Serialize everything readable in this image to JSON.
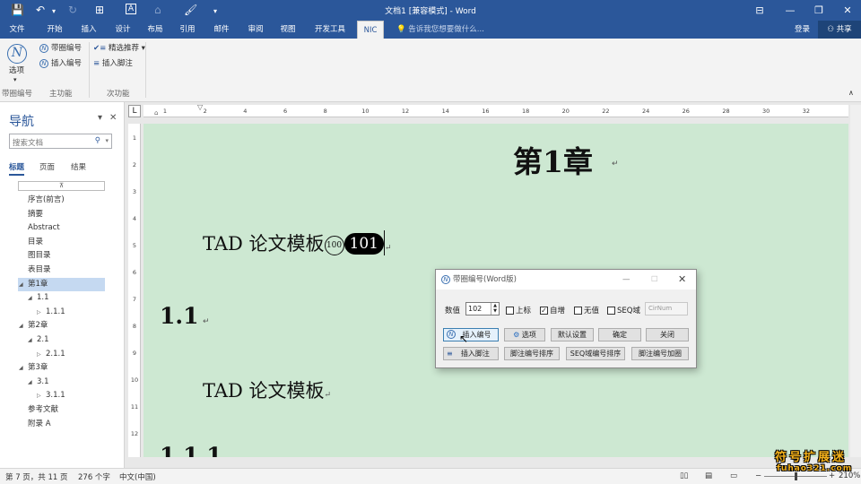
{
  "titlebar": {
    "title": "文档1 [兼容模式] - Word",
    "icons": [
      "save-icon",
      "undo-icon",
      "redo-icon",
      "table-icon",
      "text-box-icon",
      "format-painter-icon",
      "quick-access-dropdown-icon"
    ],
    "window_controls": [
      "ribbon-display-icon",
      "minimize-icon",
      "restore-icon",
      "close-icon"
    ]
  },
  "ribbon_tabs": [
    "文件",
    "开始",
    "插入",
    "设计",
    "布局",
    "引用",
    "邮件",
    "审阅",
    "视图",
    "开发工具",
    "NIC"
  ],
  "active_tab": "NIC",
  "tell_me": "告诉我您想要做什么...",
  "login": "登录",
  "share": "共享",
  "ribbon": {
    "options_big": "选项",
    "btn_circled_number": "带圈编号",
    "btn_insert_number": "插入编号",
    "btn_featured": "精选推荐",
    "btn_insert_footnote": "插入脚注",
    "group_labels": [
      "带圈编号",
      "主功能",
      "次功能"
    ]
  },
  "nav": {
    "title": "导航",
    "search_placeholder": "搜索文档",
    "tabs": [
      "标题",
      "页面",
      "结果"
    ],
    "items": [
      {
        "label": "序言(前言)",
        "level": 0,
        "caret": "",
        "selected": false
      },
      {
        "label": "摘要",
        "level": 0,
        "caret": "",
        "selected": false
      },
      {
        "label": "Abstract",
        "level": 0,
        "caret": "",
        "selected": false
      },
      {
        "label": "目录",
        "level": 0,
        "caret": "",
        "selected": false
      },
      {
        "label": "图目录",
        "level": 0,
        "caret": "",
        "selected": false
      },
      {
        "label": "表目录",
        "level": 0,
        "caret": "",
        "selected": false
      },
      {
        "label": "第1章",
        "level": 0,
        "caret": "expanded",
        "selected": true
      },
      {
        "label": "1.1",
        "level": 1,
        "caret": "expanded",
        "selected": false
      },
      {
        "label": "1.1.1",
        "level": 2,
        "caret": "collapsed",
        "selected": false
      },
      {
        "label": "第2章",
        "level": 0,
        "caret": "expanded",
        "selected": false
      },
      {
        "label": "2.1",
        "level": 1,
        "caret": "expanded",
        "selected": false
      },
      {
        "label": "2.1.1",
        "level": 2,
        "caret": "collapsed",
        "selected": false
      },
      {
        "label": "第3章",
        "level": 0,
        "caret": "expanded",
        "selected": false
      },
      {
        "label": "3.1",
        "level": 1,
        "caret": "expanded",
        "selected": false
      },
      {
        "label": "3.1.1",
        "level": 2,
        "caret": "collapsed",
        "selected": false
      },
      {
        "label": "参考文献",
        "level": 0,
        "caret": "",
        "selected": false
      },
      {
        "label": "附录 A",
        "level": 0,
        "caret": "",
        "selected": false
      }
    ]
  },
  "ruler": {
    "ticks": [
      "L",
      "1",
      "2",
      "4",
      "6",
      "8",
      "10",
      "12",
      "14",
      "16",
      "18",
      "20",
      "22",
      "24",
      "26",
      "28",
      "30",
      "32"
    ],
    "vticks": [
      "1",
      "2",
      "3",
      "4",
      "5",
      "6",
      "7",
      "8",
      "9",
      "10",
      "11",
      "12"
    ]
  },
  "document": {
    "heading1": "第1章",
    "body1": "TAD 论文模板",
    "circled_small": "100",
    "circled_black": "101",
    "heading2": "1.1",
    "body2": "TAD 论文模板",
    "heading3": "1.1.1",
    "para_mark": "↵"
  },
  "dialog": {
    "title": "带圈编号(Word版)",
    "value_label": "数值",
    "value": "102",
    "chk_superscript": "上标",
    "chk_superscript_checked": false,
    "chk_autoinc": "自增",
    "chk_autoinc_checked": true,
    "chk_no_value": "无值",
    "chk_no_value_checked": false,
    "chk_seq": "SEQ域",
    "chk_seq_checked": false,
    "seq_field_placeholder": "CirNum",
    "btn_insert_number": "插入编号",
    "btn_options": "选项",
    "btn_default": "默认设置",
    "btn_ok": "确定",
    "btn_close": "关闭",
    "btn_insert_footnote": "插入脚注",
    "btn_sort_footnote": "脚注编号排序",
    "btn_sort_seq": "SEQ域编号排序",
    "btn_bold_footnote": "脚注编号加圈"
  },
  "status": {
    "page": "第 7 页，共 11 页",
    "words": "276 个字",
    "language": "中文(中国)",
    "zoom": "210%"
  },
  "watermark": {
    "line1": "符号扩展迷",
    "line2": "fuhao321.com"
  },
  "colors": {
    "brand": "#2b579a",
    "page_bg": "#cde8d2",
    "nav_selected": "#c5d9f1",
    "watermark": "#f6b21b"
  }
}
